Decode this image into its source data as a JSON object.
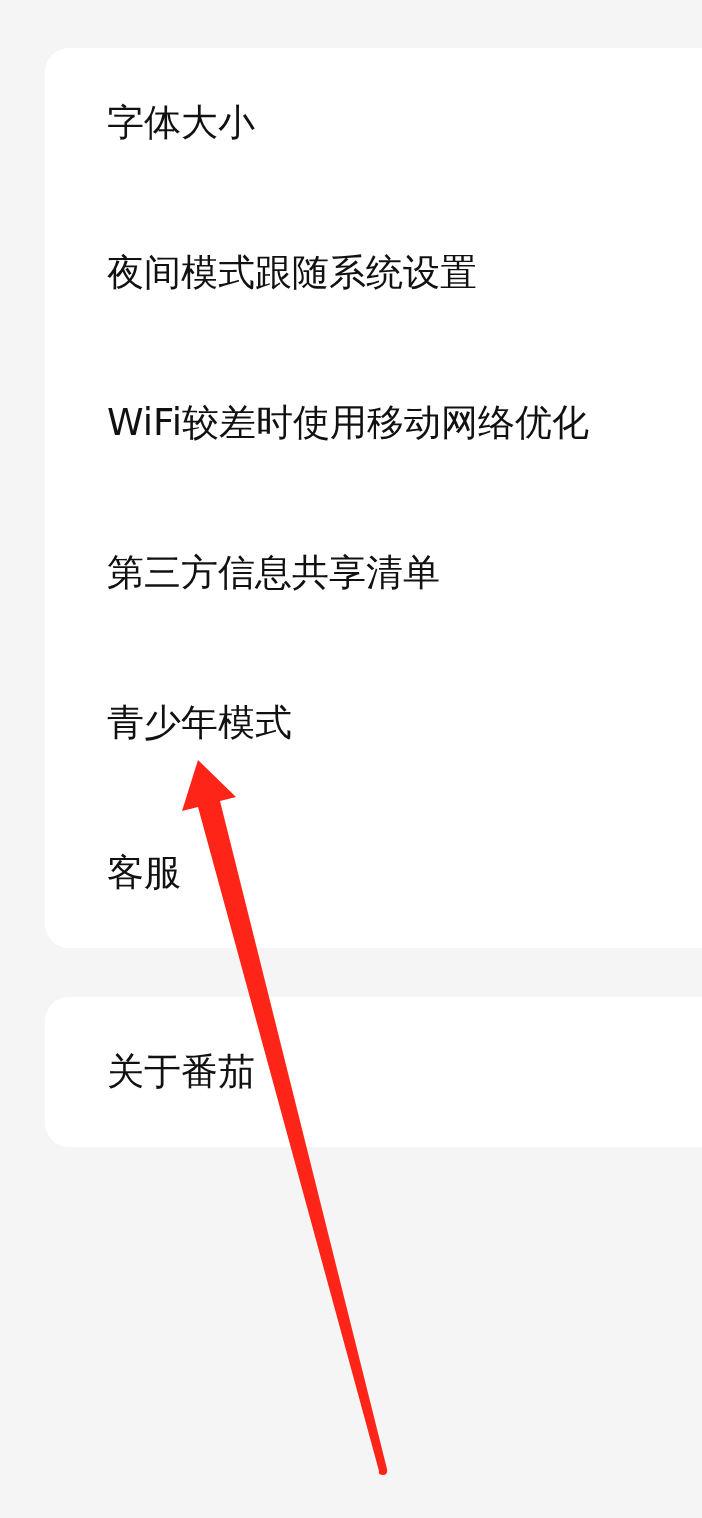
{
  "settings_groups": [
    {
      "items": [
        {
          "label": "字体大小"
        },
        {
          "label": "夜间模式跟随系统设置"
        },
        {
          "label": "WiFi较差时使用移动网络优化"
        },
        {
          "label": "第三方信息共享清单"
        },
        {
          "label": "青少年模式"
        },
        {
          "label": "客服"
        }
      ]
    },
    {
      "items": [
        {
          "label": "关于番茄"
        }
      ]
    }
  ]
}
